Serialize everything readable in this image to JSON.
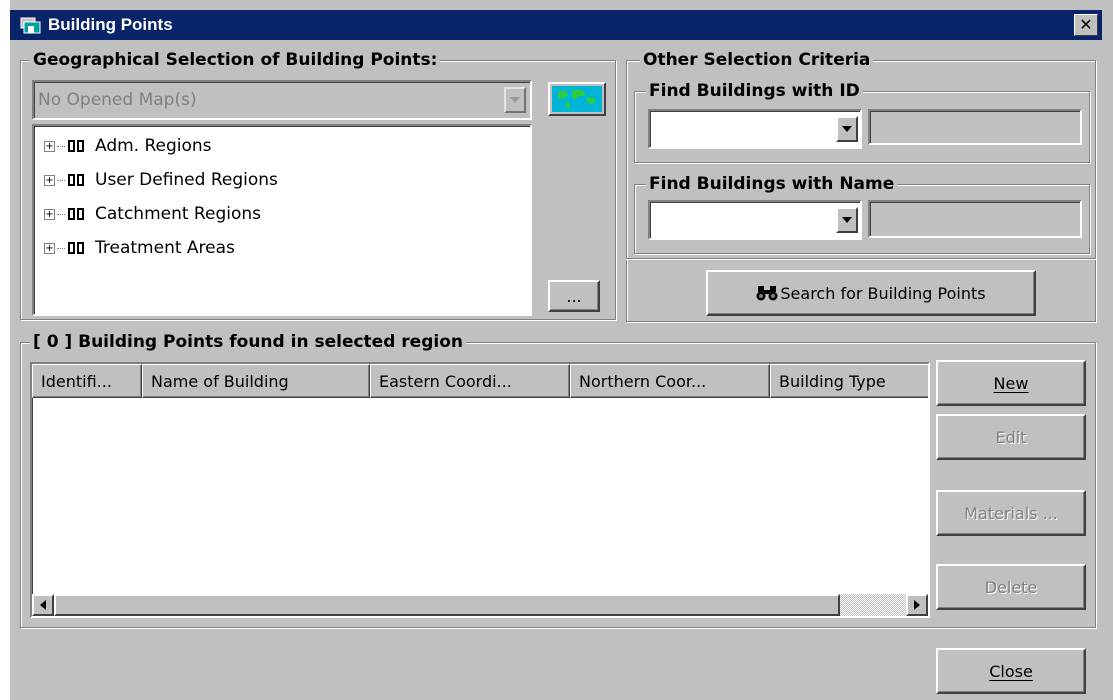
{
  "window": {
    "title": "Building Points",
    "close_label": "✕"
  },
  "geo": {
    "legend": "Geographical Selection of Building Points:",
    "map_select": "No Opened Map(s)",
    "tree": [
      {
        "label": "Adm. Regions"
      },
      {
        "label": "User Defined Regions"
      },
      {
        "label": "Catchment Regions"
      },
      {
        "label": "Treatment Areas"
      }
    ],
    "ellipsis_label": "..."
  },
  "criteria": {
    "legend": "Other Selection Criteria",
    "id_legend": "Find Buildings with  ID",
    "name_legend": "Find Buildings with  Name",
    "search_label": "Search for Building Points"
  },
  "results": {
    "legend": "[ 0 ] Building Points found in selected region",
    "columns": [
      "Identifi...",
      "Name of Building",
      "Eastern Coordi...",
      "Northern Coor...",
      "Building Type"
    ],
    "new_label": "New",
    "edit_label": "Edit",
    "materials_label": "Materials ...",
    "delete_label": "Delete"
  },
  "footer": {
    "close_label": "Close"
  },
  "colors": {
    "titlebar": "#0a246a",
    "face": "#c0c0c0"
  }
}
